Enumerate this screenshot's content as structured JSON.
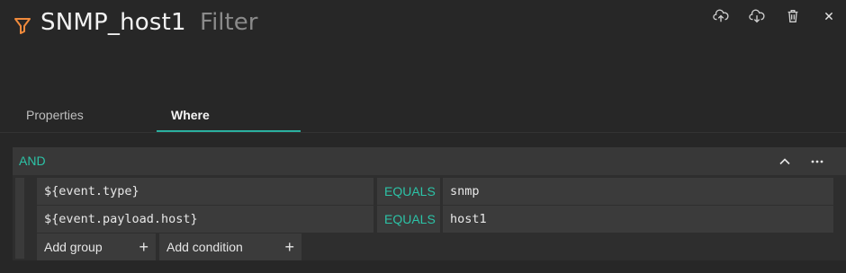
{
  "header": {
    "title": "SNMP_host1",
    "subtitle": "Filter",
    "icon": "filter-icon",
    "accent_color": "#f08a3c",
    "actions": [
      "upload-icon",
      "download-icon",
      "trash-icon",
      "close-icon"
    ]
  },
  "tabs": [
    {
      "label": "Properties",
      "active": false
    },
    {
      "label": "Where",
      "active": true
    }
  ],
  "condition_group": {
    "operator": "AND",
    "rows": [
      {
        "field": "${event.type}",
        "op": "EQUALS",
        "value": "snmp"
      },
      {
        "field": "${event.payload.host}",
        "op": "EQUALS",
        "value": "host1"
      }
    ],
    "add_group_label": "Add group",
    "add_condition_label": "Add condition",
    "accent_color": "#2cc3a7"
  }
}
